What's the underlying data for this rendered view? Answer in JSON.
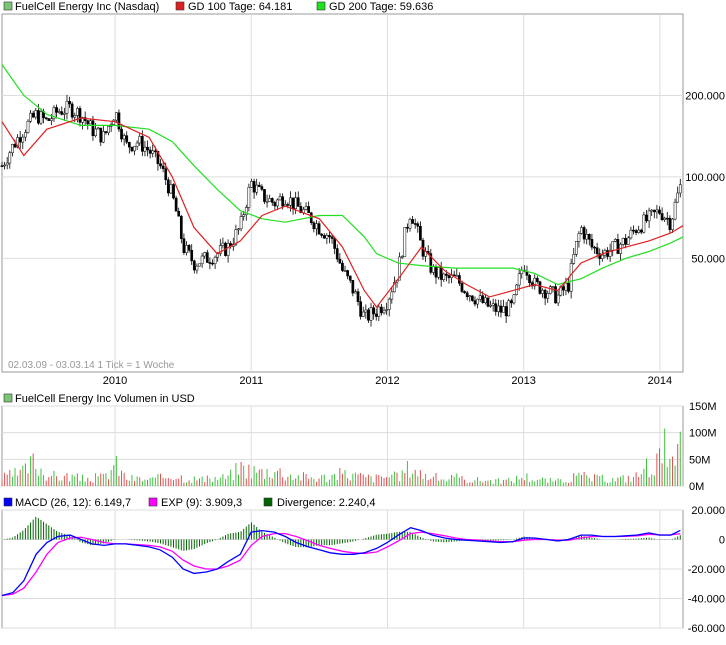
{
  "chart_data": [
    {
      "type": "candlestick",
      "panel": "price",
      "legend": [
        {
          "label": "FuelCell Energy Inc (Nasdaq)",
          "color": "#7cc576"
        },
        {
          "label": "GD 100 Tage: 64.181",
          "color": "#e02020"
        },
        {
          "label": "GD 200 Tage: 59.636",
          "color": "#20e020"
        }
      ],
      "y_scale": "log",
      "y_ticks": [
        "200.000",
        "100.000",
        "50.000"
      ],
      "y_tick_values": [
        200,
        100,
        50
      ],
      "ylim": [
        19,
        400
      ],
      "x_ticks": [
        "2010",
        "2011",
        "2012",
        "2013",
        "2014"
      ],
      "x_tick_values": [
        2010.0,
        2011.0,
        2012.0,
        2013.0,
        2014.0
      ],
      "xlim": [
        2009.17,
        2014.17
      ],
      "footer": "02.03.09 - 03.03.14   1 Tick = 1 Woche",
      "close": [
        [
          2009.17,
          110
        ],
        [
          2009.25,
          130
        ],
        [
          2009.33,
          150
        ],
        [
          2009.42,
          170
        ],
        [
          2009.5,
          160
        ],
        [
          2009.58,
          175
        ],
        [
          2009.67,
          180
        ],
        [
          2009.75,
          170
        ],
        [
          2009.83,
          150
        ],
        [
          2009.92,
          140
        ],
        [
          2010.0,
          175
        ],
        [
          2010.08,
          130
        ],
        [
          2010.17,
          135
        ],
        [
          2010.25,
          125
        ],
        [
          2010.33,
          110
        ],
        [
          2010.42,
          85
        ],
        [
          2010.5,
          55
        ],
        [
          2010.58,
          48
        ],
        [
          2010.67,
          50
        ],
        [
          2010.75,
          52
        ],
        [
          2010.83,
          55
        ],
        [
          2010.92,
          65
        ],
        [
          2011.0,
          95
        ],
        [
          2011.08,
          85
        ],
        [
          2011.17,
          80
        ],
        [
          2011.25,
          85
        ],
        [
          2011.33,
          78
        ],
        [
          2011.42,
          72
        ],
        [
          2011.5,
          65
        ],
        [
          2011.58,
          60
        ],
        [
          2011.67,
          45
        ],
        [
          2011.75,
          38
        ],
        [
          2011.83,
          30
        ],
        [
          2011.92,
          32
        ],
        [
          2012.0,
          35
        ],
        [
          2012.08,
          45
        ],
        [
          2012.17,
          75
        ],
        [
          2012.25,
          55
        ],
        [
          2012.33,
          45
        ],
        [
          2012.42,
          42
        ],
        [
          2012.5,
          42
        ],
        [
          2012.58,
          38
        ],
        [
          2012.67,
          35
        ],
        [
          2012.75,
          33
        ],
        [
          2012.83,
          32
        ],
        [
          2012.92,
          33
        ],
        [
          2013.0,
          48
        ],
        [
          2013.08,
          40
        ],
        [
          2013.17,
          38
        ],
        [
          2013.25,
          36
        ],
        [
          2013.33,
          40
        ],
        [
          2013.42,
          65
        ],
        [
          2013.5,
          55
        ],
        [
          2013.58,
          52
        ],
        [
          2013.67,
          55
        ],
        [
          2013.75,
          58
        ],
        [
          2013.83,
          65
        ],
        [
          2013.92,
          70
        ],
        [
          2014.0,
          75
        ],
        [
          2014.08,
          68
        ],
        [
          2014.15,
          92
        ]
      ],
      "gd100": [
        [
          2009.17,
          160
        ],
        [
          2009.33,
          120
        ],
        [
          2009.5,
          150
        ],
        [
          2009.75,
          165
        ],
        [
          2010.0,
          160
        ],
        [
          2010.25,
          140
        ],
        [
          2010.42,
          100
        ],
        [
          2010.58,
          65
        ],
        [
          2010.75,
          52
        ],
        [
          2010.92,
          58
        ],
        [
          2011.08,
          72
        ],
        [
          2011.25,
          78
        ],
        [
          2011.5,
          70
        ],
        [
          2011.67,
          55
        ],
        [
          2011.83,
          38
        ],
        [
          2011.92,
          33
        ],
        [
          2012.08,
          42
        ],
        [
          2012.25,
          55
        ],
        [
          2012.42,
          45
        ],
        [
          2012.58,
          40
        ],
        [
          2012.75,
          36
        ],
        [
          2012.92,
          38
        ],
        [
          2013.08,
          40
        ],
        [
          2013.25,
          38
        ],
        [
          2013.42,
          48
        ],
        [
          2013.58,
          52
        ],
        [
          2013.75,
          55
        ],
        [
          2013.92,
          58
        ],
        [
          2014.08,
          62
        ],
        [
          2014.17,
          66
        ]
      ],
      "gd200": [
        [
          2009.17,
          260
        ],
        [
          2009.33,
          200
        ],
        [
          2009.5,
          170
        ],
        [
          2009.75,
          155
        ],
        [
          2010.0,
          155
        ],
        [
          2010.25,
          150
        ],
        [
          2010.42,
          135
        ],
        [
          2010.58,
          110
        ],
        [
          2010.75,
          90
        ],
        [
          2010.92,
          75
        ],
        [
          2011.08,
          70
        ],
        [
          2011.25,
          68
        ],
        [
          2011.5,
          72
        ],
        [
          2011.67,
          72
        ],
        [
          2011.83,
          60
        ],
        [
          2011.92,
          52
        ],
        [
          2012.08,
          48
        ],
        [
          2012.25,
          47
        ],
        [
          2012.5,
          46
        ],
        [
          2012.75,
          46
        ],
        [
          2012.92,
          46
        ],
        [
          2013.08,
          44
        ],
        [
          2013.25,
          40
        ],
        [
          2013.42,
          42
        ],
        [
          2013.58,
          46
        ],
        [
          2013.75,
          50
        ],
        [
          2013.92,
          53
        ],
        [
          2014.08,
          57
        ],
        [
          2014.17,
          60
        ]
      ]
    },
    {
      "type": "bar",
      "panel": "volume",
      "legend": [
        {
          "label": "FuelCell Energy Inc Volumen in USD",
          "color": "#7cc576"
        }
      ],
      "y_ticks": [
        "150M",
        "100M",
        "50M",
        "0M"
      ],
      "y_tick_values": [
        150,
        100,
        50,
        0
      ],
      "ylim": [
        0,
        150
      ],
      "unit": "M USD",
      "values": [
        [
          2009.17,
          20
        ],
        [
          2009.25,
          28
        ],
        [
          2009.33,
          35
        ],
        [
          2009.4,
          60
        ],
        [
          2009.5,
          30
        ],
        [
          2009.58,
          22
        ],
        [
          2009.67,
          25
        ],
        [
          2009.75,
          18
        ],
        [
          2009.83,
          20
        ],
        [
          2009.92,
          22
        ],
        [
          2010.0,
          55
        ],
        [
          2010.08,
          20
        ],
        [
          2010.17,
          18
        ],
        [
          2010.25,
          15
        ],
        [
          2010.33,
          20
        ],
        [
          2010.42,
          30
        ],
        [
          2010.5,
          22
        ],
        [
          2010.58,
          18
        ],
        [
          2010.67,
          16
        ],
        [
          2010.75,
          20
        ],
        [
          2010.83,
          22
        ],
        [
          2010.92,
          48
        ],
        [
          2011.0,
          40
        ],
        [
          2011.08,
          35
        ],
        [
          2011.17,
          42
        ],
        [
          2011.25,
          30
        ],
        [
          2011.33,
          25
        ],
        [
          2011.42,
          22
        ],
        [
          2011.5,
          20
        ],
        [
          2011.58,
          25
        ],
        [
          2011.67,
          30
        ],
        [
          2011.75,
          28
        ],
        [
          2011.83,
          22
        ],
        [
          2011.92,
          20
        ],
        [
          2012.0,
          25
        ],
        [
          2012.08,
          22
        ],
        [
          2012.17,
          50
        ],
        [
          2012.25,
          30
        ],
        [
          2012.33,
          22
        ],
        [
          2012.42,
          18
        ],
        [
          2012.5,
          20
        ],
        [
          2012.58,
          16
        ],
        [
          2012.67,
          15
        ],
        [
          2012.75,
          14
        ],
        [
          2012.83,
          12
        ],
        [
          2012.92,
          15
        ],
        [
          2013.0,
          25
        ],
        [
          2013.08,
          18
        ],
        [
          2013.17,
          14
        ],
        [
          2013.25,
          12
        ],
        [
          2013.33,
          18
        ],
        [
          2013.42,
          25
        ],
        [
          2013.5,
          20
        ],
        [
          2013.58,
          18
        ],
        [
          2013.67,
          16
        ],
        [
          2013.75,
          20
        ],
        [
          2013.83,
          25
        ],
        [
          2013.92,
          55
        ],
        [
          2014.0,
          65
        ],
        [
          2014.03,
          100
        ],
        [
          2014.08,
          45
        ],
        [
          2014.12,
          60
        ],
        [
          2014.15,
          88
        ]
      ]
    },
    {
      "type": "line",
      "panel": "macd",
      "legend": [
        {
          "label": "MACD (26, 12): 6.149,7",
          "color": "#0000ff"
        },
        {
          "label": "EXP (9): 3.909,3",
          "color": "#ff00ff"
        },
        {
          "label": "Divergence: 2.240,4",
          "color": "#006400"
        }
      ],
      "y_ticks": [
        "20.000",
        "0",
        "-20.000",
        "-40.000",
        "-60.000"
      ],
      "y_tick_values": [
        20000,
        0,
        -20000,
        -40000,
        -60000
      ],
      "ylim": [
        -60000,
        20000
      ],
      "macd": [
        [
          2009.17,
          -38000
        ],
        [
          2009.25,
          -36000
        ],
        [
          2009.33,
          -28000
        ],
        [
          2009.42,
          -10000
        ],
        [
          2009.5,
          -2000
        ],
        [
          2009.58,
          2000
        ],
        [
          2009.67,
          3000
        ],
        [
          2009.75,
          0
        ],
        [
          2009.83,
          -3000
        ],
        [
          2009.92,
          -4000
        ],
        [
          2010.0,
          -3000
        ],
        [
          2010.08,
          -3000
        ],
        [
          2010.17,
          -4000
        ],
        [
          2010.25,
          -5000
        ],
        [
          2010.33,
          -7000
        ],
        [
          2010.42,
          -12000
        ],
        [
          2010.5,
          -20000
        ],
        [
          2010.58,
          -23000
        ],
        [
          2010.67,
          -22000
        ],
        [
          2010.75,
          -20000
        ],
        [
          2010.83,
          -15000
        ],
        [
          2010.92,
          -10000
        ],
        [
          2011.0,
          5000
        ],
        [
          2011.08,
          6000
        ],
        [
          2011.17,
          5000
        ],
        [
          2011.25,
          2000
        ],
        [
          2011.33,
          -2000
        ],
        [
          2011.42,
          -5000
        ],
        [
          2011.5,
          -7000
        ],
        [
          2011.58,
          -9000
        ],
        [
          2011.67,
          -10000
        ],
        [
          2011.75,
          -10000
        ],
        [
          2011.83,
          -9000
        ],
        [
          2011.92,
          -6000
        ],
        [
          2012.0,
          -2000
        ],
        [
          2012.08,
          3000
        ],
        [
          2012.17,
          8000
        ],
        [
          2012.25,
          6000
        ],
        [
          2012.33,
          3000
        ],
        [
          2012.42,
          1000
        ],
        [
          2012.5,
          0
        ],
        [
          2012.58,
          -500
        ],
        [
          2012.67,
          -1000
        ],
        [
          2012.75,
          -1500
        ],
        [
          2012.83,
          -2000
        ],
        [
          2012.92,
          -1500
        ],
        [
          2013.0,
          1000
        ],
        [
          2013.08,
          1000
        ],
        [
          2013.17,
          0
        ],
        [
          2013.25,
          -1000
        ],
        [
          2013.33,
          0
        ],
        [
          2013.42,
          3000
        ],
        [
          2013.5,
          3000
        ],
        [
          2013.58,
          2000
        ],
        [
          2013.67,
          2000
        ],
        [
          2013.75,
          2500
        ],
        [
          2013.83,
          3000
        ],
        [
          2013.92,
          4500
        ],
        [
          2014.0,
          3000
        ],
        [
          2014.08,
          3000
        ],
        [
          2014.15,
          6150
        ]
      ],
      "exp": [
        [
          2009.17,
          -38000
        ],
        [
          2009.25,
          -37000
        ],
        [
          2009.33,
          -33000
        ],
        [
          2009.42,
          -22000
        ],
        [
          2009.5,
          -10000
        ],
        [
          2009.58,
          -2000
        ],
        [
          2009.67,
          1000
        ],
        [
          2009.75,
          1500
        ],
        [
          2009.83,
          0
        ],
        [
          2009.92,
          -2000
        ],
        [
          2010.0,
          -3000
        ],
        [
          2010.08,
          -3000
        ],
        [
          2010.17,
          -3500
        ],
        [
          2010.25,
          -4000
        ],
        [
          2010.33,
          -5000
        ],
        [
          2010.42,
          -8000
        ],
        [
          2010.5,
          -14000
        ],
        [
          2010.58,
          -18000
        ],
        [
          2010.67,
          -20000
        ],
        [
          2010.75,
          -20000
        ],
        [
          2010.83,
          -18000
        ],
        [
          2010.92,
          -14000
        ],
        [
          2011.0,
          -4000
        ],
        [
          2011.08,
          2000
        ],
        [
          2011.17,
          4000
        ],
        [
          2011.25,
          4000
        ],
        [
          2011.33,
          2000
        ],
        [
          2011.42,
          -1000
        ],
        [
          2011.5,
          -4000
        ],
        [
          2011.58,
          -6000
        ],
        [
          2011.67,
          -8000
        ],
        [
          2011.75,
          -9000
        ],
        [
          2011.83,
          -9500
        ],
        [
          2011.92,
          -8500
        ],
        [
          2012.0,
          -5000
        ],
        [
          2012.08,
          -1000
        ],
        [
          2012.17,
          4000
        ],
        [
          2012.25,
          5000
        ],
        [
          2012.33,
          4000
        ],
        [
          2012.42,
          2500
        ],
        [
          2012.5,
          1000
        ],
        [
          2012.58,
          0
        ],
        [
          2012.67,
          -500
        ],
        [
          2012.75,
          -1000
        ],
        [
          2012.83,
          -1500
        ],
        [
          2012.92,
          -1500
        ],
        [
          2013.0,
          -500
        ],
        [
          2013.08,
          0
        ],
        [
          2013.17,
          0
        ],
        [
          2013.25,
          -500
        ],
        [
          2013.33,
          -500
        ],
        [
          2013.42,
          1000
        ],
        [
          2013.5,
          2000
        ],
        [
          2013.58,
          2000
        ],
        [
          2013.67,
          2000
        ],
        [
          2013.75,
          2200
        ],
        [
          2013.83,
          2500
        ],
        [
          2013.92,
          3500
        ],
        [
          2014.0,
          3200
        ],
        [
          2014.08,
          3100
        ],
        [
          2014.15,
          3909
        ]
      ]
    }
  ]
}
